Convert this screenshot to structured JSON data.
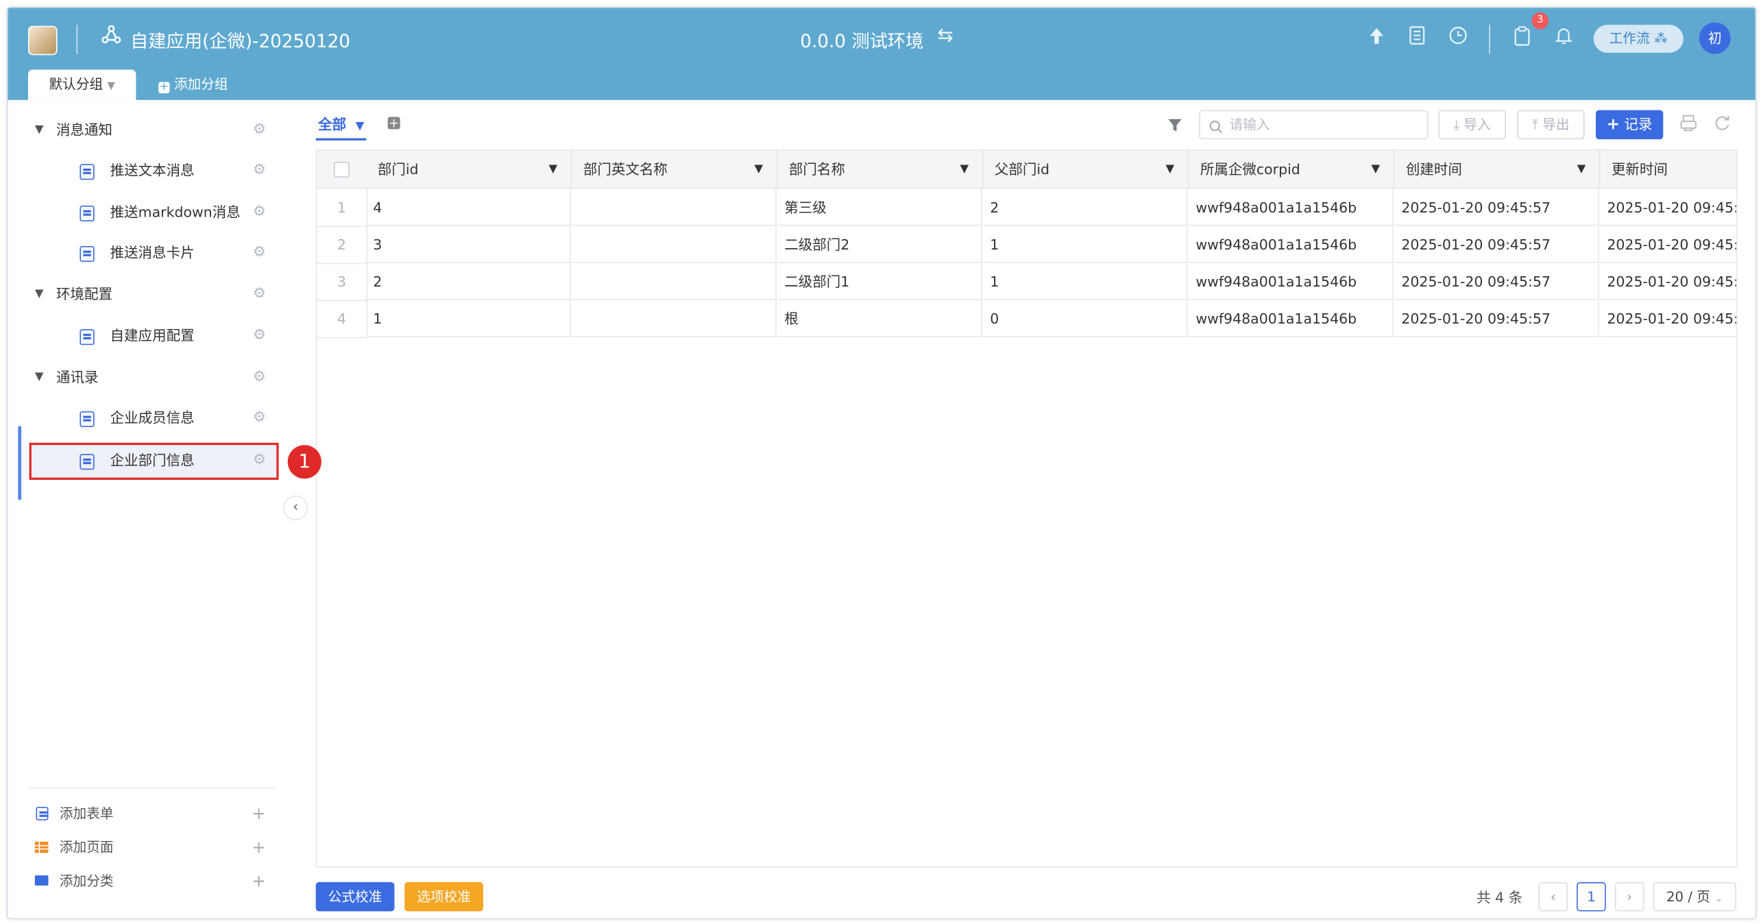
{
  "header": {
    "app_title": "自建应用(企微)-20250120",
    "env_title": "0.0.0 测试环境",
    "notification_count": "3",
    "workflow_label": "工作流",
    "avatar_text": "初"
  },
  "group_tabs": {
    "default_group": "默认分组",
    "add_group": "添加分组"
  },
  "sidebar": {
    "groups": [
      {
        "label": "消息通知",
        "items": [
          "推送文本消息",
          "推送markdown消息",
          "推送消息卡片"
        ]
      },
      {
        "label": "环境配置",
        "items": [
          "自建应用配置"
        ]
      },
      {
        "label": "通讯录",
        "items": [
          "企业成员信息",
          "企业部门信息"
        ]
      }
    ],
    "annotation_number": "1",
    "footer": {
      "add_form": "添加表单",
      "add_page": "添加页面",
      "add_category": "添加分类"
    }
  },
  "toolbar": {
    "view_tab": "全部",
    "search_placeholder": "请输入",
    "import_label": "导入",
    "export_label": "导出",
    "add_record_label": "记录"
  },
  "table": {
    "columns": [
      "部门id",
      "部门英文名称",
      "部门名称",
      "父部门id",
      "所属企微corpid",
      "创建时间",
      "更新时间"
    ],
    "rows": [
      {
        "n": "1",
        "cells": [
          "4",
          "",
          "第三级",
          "2",
          "wwf948a001a1a1546b",
          "2025-01-20 09:45:57",
          "2025-01-20 09:45:"
        ]
      },
      {
        "n": "2",
        "cells": [
          "3",
          "",
          "二级部门2",
          "1",
          "wwf948a001a1a1546b",
          "2025-01-20 09:45:57",
          "2025-01-20 09:45:"
        ]
      },
      {
        "n": "3",
        "cells": [
          "2",
          "",
          "二级部门1",
          "1",
          "wwf948a001a1a1546b",
          "2025-01-20 09:45:57",
          "2025-01-20 09:45:"
        ]
      },
      {
        "n": "4",
        "cells": [
          "1",
          "",
          "根",
          "0",
          "wwf948a001a1a1546b",
          "2025-01-20 09:45:57",
          "2025-01-20 09:45:"
        ]
      }
    ]
  },
  "footer": {
    "formula_check": "公式校准",
    "option_check": "选项校准",
    "total_text": "共 4 条",
    "current_page": "1",
    "page_size": "20 / 页"
  },
  "colors": {
    "header_bg": "#5fa9d0",
    "primary": "#3b6be0",
    "warning": "#f5a623",
    "annotation_red": "#e02a2a"
  }
}
